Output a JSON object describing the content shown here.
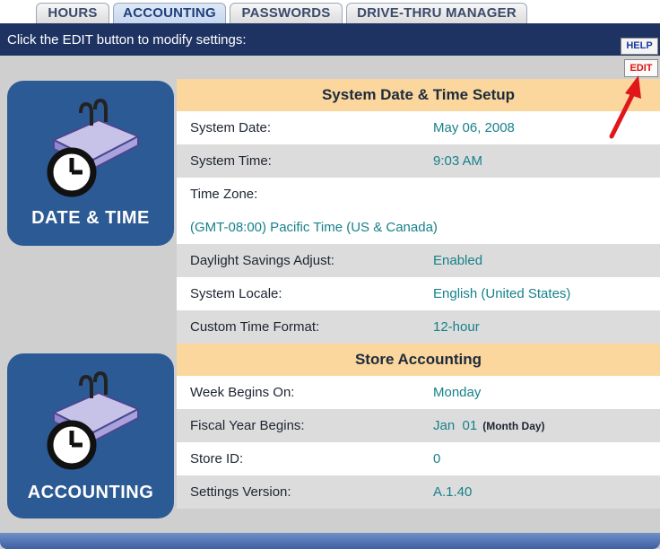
{
  "tabs": [
    {
      "label": "HOURS"
    },
    {
      "label": "ACCOUNTING"
    },
    {
      "label": "PASSWORDS"
    },
    {
      "label": "DRIVE-THRU MANAGER"
    }
  ],
  "active_tab_index": 1,
  "titlebar": {
    "message": "Click the EDIT button to modify settings:"
  },
  "buttons": {
    "help": "HELP",
    "edit": "EDIT"
  },
  "panels": {
    "date_time": "DATE & TIME",
    "accounting": "ACCOUNTING"
  },
  "date_time_section": {
    "header": "System Date & Time Setup",
    "system_date_label": "System Date:",
    "system_date_value": "May 06, 2008",
    "system_time_label": "System Time:",
    "system_time_value": "9:03 AM",
    "time_zone_label": "Time Zone:",
    "time_zone_value": "(GMT-08:00) Pacific Time (US & Canada)",
    "dst_label": "Daylight Savings Adjust:",
    "dst_value": "Enabled",
    "locale_label": "System Locale:",
    "locale_value": "English (United States)",
    "time_format_label": "Custom Time Format:",
    "time_format_value": "12-hour"
  },
  "accounting_section": {
    "header": "Store Accounting",
    "week_label": "Week Begins On:",
    "week_value": "Monday",
    "fiscal_label": "Fiscal Year Begins:",
    "fiscal_value": "Jan  01",
    "fiscal_note": "(Month Day)",
    "store_label": "Store ID:",
    "store_value": "0",
    "version_label": "Settings Version:",
    "version_value": "A.1.40"
  },
  "colors": {
    "titlebar": "#1f3363",
    "panel": "#2c5a94",
    "header": "#fbd79d",
    "value_text": "#17818a",
    "arrow": "#e0161a"
  }
}
